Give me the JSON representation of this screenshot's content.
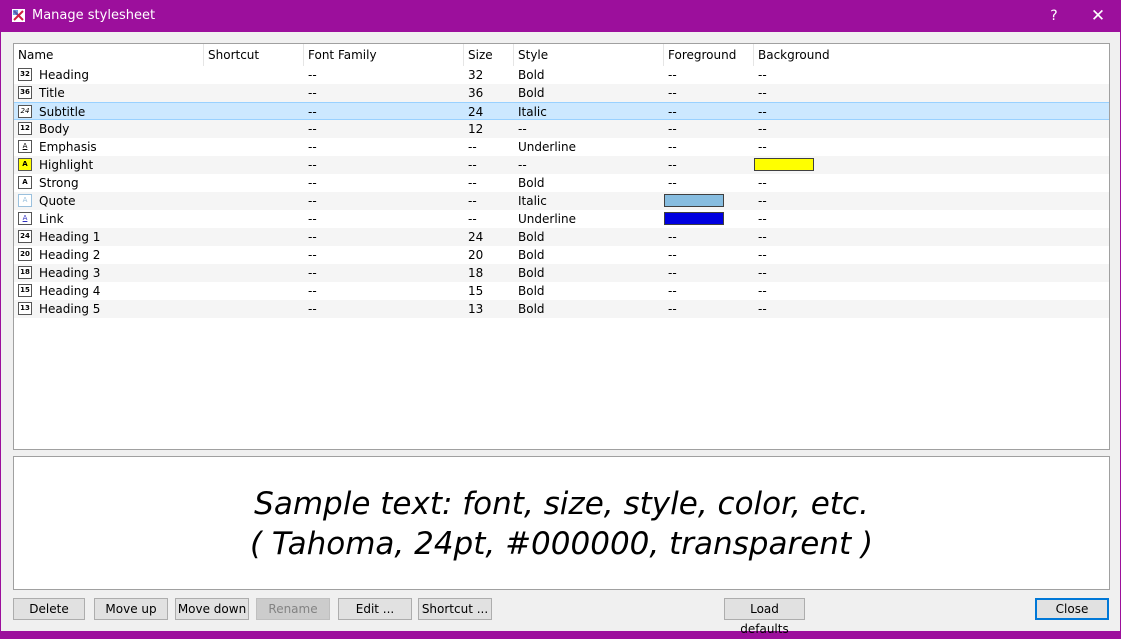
{
  "window": {
    "title": "Manage stylesheet",
    "help_glyph": "?",
    "close_glyph": "✕"
  },
  "columns": [
    "Name",
    "Shortcut",
    "Font Family",
    "Size",
    "Style",
    "Foreground",
    "Background"
  ],
  "rows": [
    {
      "icon": "32",
      "name": "Heading",
      "shortcut": "",
      "font": "--",
      "size": "32",
      "style": "Bold",
      "fg": "--",
      "bg": "--"
    },
    {
      "icon": "36",
      "name": "Title",
      "shortcut": "",
      "font": "--",
      "size": "36",
      "style": "Bold",
      "fg": "--",
      "bg": "--"
    },
    {
      "icon": "24",
      "name": "Subtitle",
      "shortcut": "",
      "font": "--",
      "size": "24",
      "style": "Italic",
      "fg": "--",
      "bg": "--",
      "selected": true
    },
    {
      "icon": "12",
      "name": "Body",
      "shortcut": "",
      "font": "--",
      "size": "12",
      "style": "--",
      "fg": "--",
      "bg": "--"
    },
    {
      "icon": "A",
      "name": "Emphasis",
      "shortcut": "",
      "font": "--",
      "size": "--",
      "style": "Underline",
      "fg": "--",
      "bg": "--"
    },
    {
      "icon": "A",
      "name": "Highlight",
      "shortcut": "",
      "font": "--",
      "size": "--",
      "style": "--",
      "fg": "--",
      "bg_color": "#ffff00"
    },
    {
      "icon": "A",
      "name": "Strong",
      "shortcut": "",
      "font": "--",
      "size": "--",
      "style": "Bold",
      "fg": "--",
      "bg": "--"
    },
    {
      "icon": "A",
      "name": "Quote",
      "shortcut": "",
      "font": "--",
      "size": "--",
      "style": "Italic",
      "fg_color": "#87bde0",
      "bg": "--"
    },
    {
      "icon": "A",
      "name": "Link",
      "shortcut": "",
      "font": "--",
      "size": "--",
      "style": "Underline",
      "fg_color": "#0000e0",
      "bg": "--"
    },
    {
      "icon": "24",
      "name": "Heading 1",
      "shortcut": "",
      "font": "--",
      "size": "24",
      "style": "Bold",
      "fg": "--",
      "bg": "--"
    },
    {
      "icon": "20",
      "name": "Heading 2",
      "shortcut": "",
      "font": "--",
      "size": "20",
      "style": "Bold",
      "fg": "--",
      "bg": "--"
    },
    {
      "icon": "18",
      "name": "Heading 3",
      "shortcut": "",
      "font": "--",
      "size": "18",
      "style": "Bold",
      "fg": "--",
      "bg": "--"
    },
    {
      "icon": "15",
      "name": "Heading 4",
      "shortcut": "",
      "font": "--",
      "size": "15",
      "style": "Bold",
      "fg": "--",
      "bg": "--"
    },
    {
      "icon": "13",
      "name": "Heading 5",
      "shortcut": "",
      "font": "--",
      "size": "13",
      "style": "Bold",
      "fg": "--",
      "bg": "--"
    }
  ],
  "preview": {
    "line1": "Sample text: font, size, style, color, etc.",
    "line2": "( Tahoma, 24pt, #000000, transparent )"
  },
  "buttons": {
    "delete": "Delete",
    "move_up": "Move up",
    "move_down": "Move down",
    "rename": "Rename",
    "edit": "Edit ...",
    "shortcut": "Shortcut ...",
    "load_defaults": "Load defaults",
    "close": "Close"
  },
  "colors": {
    "titlebar": "#9c0f9c",
    "selection": "#cce8ff"
  }
}
